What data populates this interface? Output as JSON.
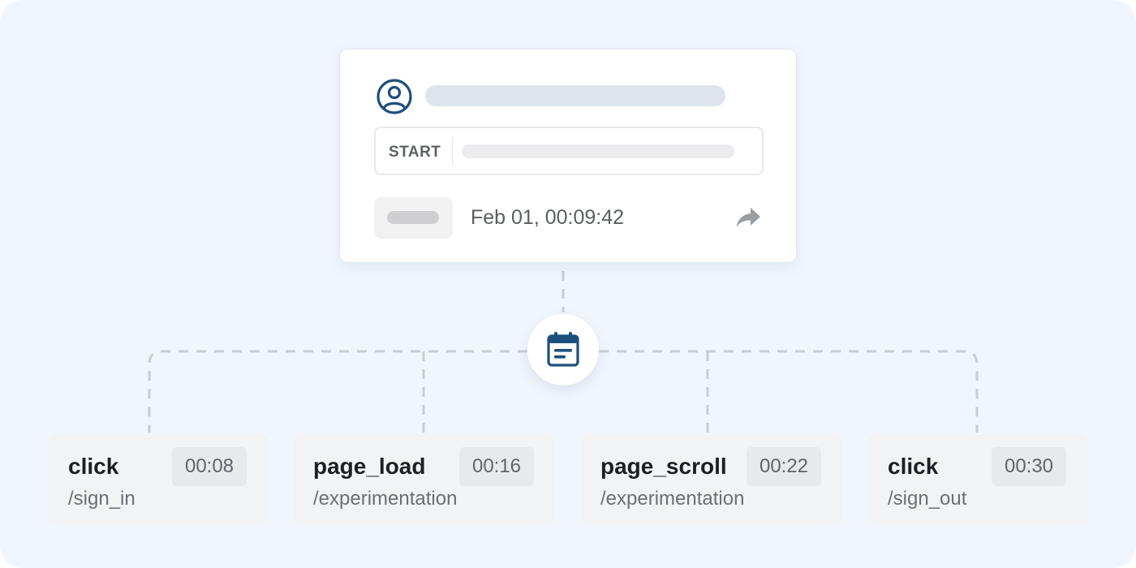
{
  "session": {
    "start_label": "START",
    "timestamp": "Feb 01, 00:09:42",
    "icons": {
      "user": "user-circle-icon",
      "share": "share-arrow-icon",
      "hub": "calendar-icon"
    },
    "colors": {
      "accent": "#1d4f7c",
      "background": "#f1f6fd"
    }
  },
  "events": [
    {
      "name": "click",
      "path": "/sign_in",
      "time": "00:08"
    },
    {
      "name": "page_load",
      "path": "/experimentation",
      "time": "00:16"
    },
    {
      "name": "page_scroll",
      "path": "/experimentation",
      "time": "00:22"
    },
    {
      "name": "click",
      "path": "/sign_out",
      "time": "00:30"
    }
  ]
}
